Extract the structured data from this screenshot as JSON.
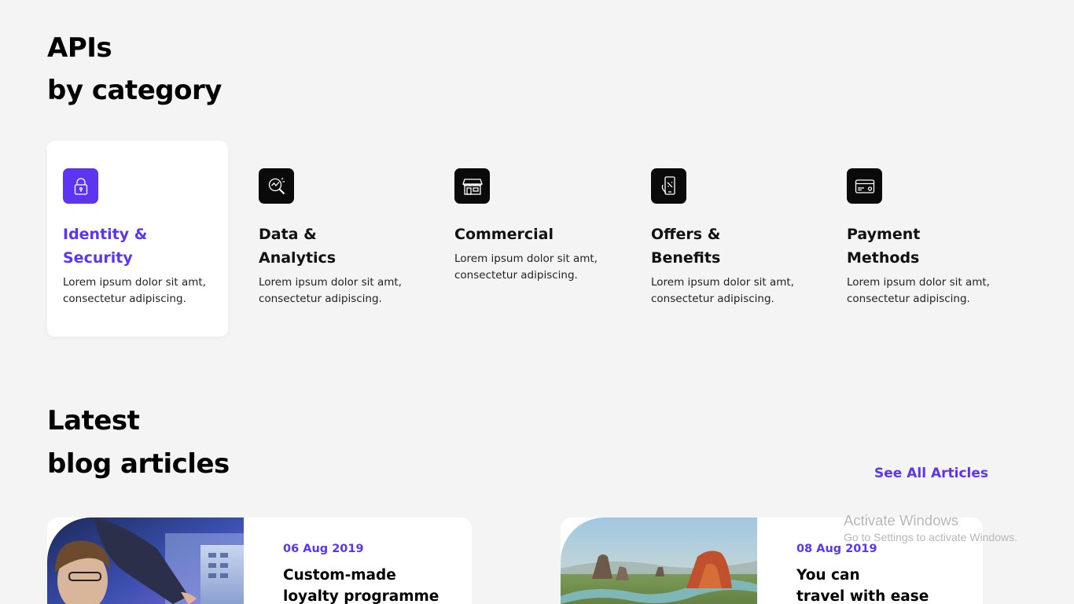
{
  "apis_section": {
    "title_line1": "APIs",
    "title_line2": "by category"
  },
  "categories": [
    {
      "icon": "lock-icon",
      "title_line1": "Identity &",
      "title_line2": "Security",
      "description": "Lorem ipsum dolor sit amt, consectetur adipiscing.",
      "active": true
    },
    {
      "icon": "analytics-magnifier-icon",
      "title_line1": "Data &",
      "title_line2": "Analytics",
      "description": "Lorem ipsum dolor sit amt, consectetur adipiscing.",
      "active": false
    },
    {
      "icon": "storefront-icon",
      "title_line1": "Commercial",
      "title_line2": "",
      "description": "Lorem ipsum dolor sit amt, consectetur adipiscing.",
      "active": false
    },
    {
      "icon": "mobile-offer-icon",
      "title_line1": "Offers &",
      "title_line2": "Benefits",
      "description": "Lorem ipsum dolor sit amt, consectetur adipiscing.",
      "active": false
    },
    {
      "icon": "credit-card-icon",
      "title_line1": "Payment",
      "title_line2": "Methods",
      "description": "Lorem ipsum dolor sit amt, consectetur adipiscing.",
      "active": false
    }
  ],
  "blog_section": {
    "title_line1": "Latest",
    "title_line2": "blog articles",
    "see_all_label": "See All Articles"
  },
  "blog_cards": [
    {
      "date": "06 Aug 2019",
      "title_line1": "Custom-made",
      "title_line2": "loyalty programme"
    },
    {
      "date": "08 Aug 2019",
      "title_line1": "You can",
      "title_line2": "travel with ease"
    }
  ],
  "os_watermark": {
    "title": "Activate Windows",
    "subtitle": "Go to Settings to activate Windows."
  },
  "colors": {
    "accent": "#5b35f0",
    "background": "#f4f4f4",
    "card": "#ffffff",
    "icon_bg": "#0a0a0a"
  }
}
